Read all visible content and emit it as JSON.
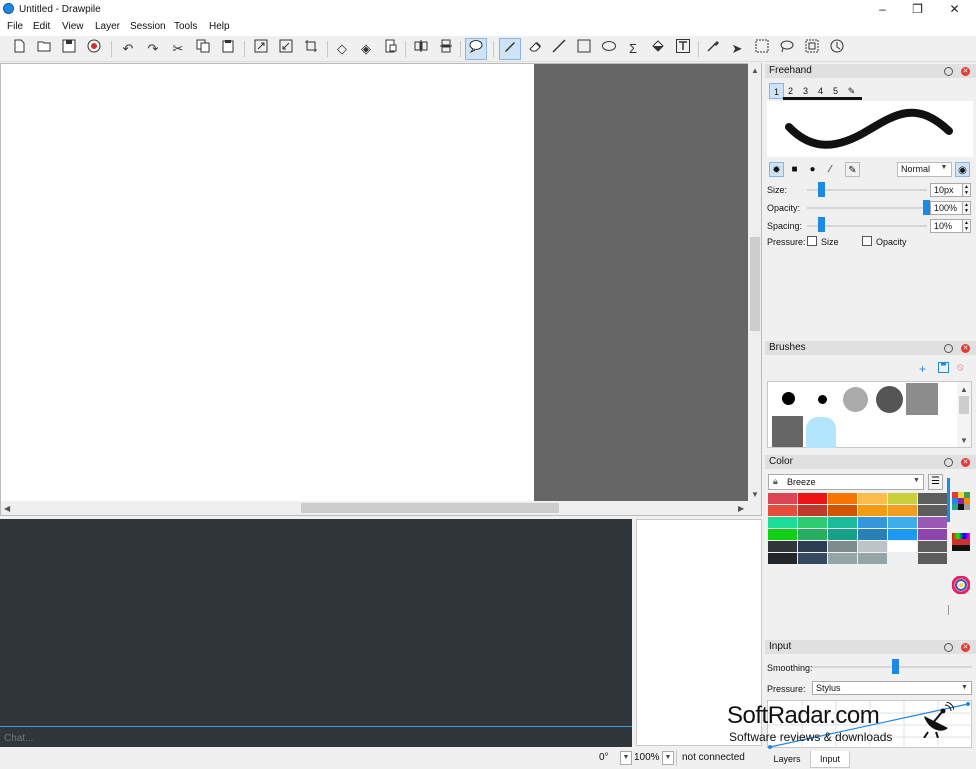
{
  "window": {
    "title": "Untitled - Drawpile",
    "minimize_glyph": "–",
    "maximize_glyph": "❐",
    "close_glyph": "✕"
  },
  "menu": [
    "File",
    "Edit",
    "View",
    "Layer",
    "Session",
    "Tools",
    "Help"
  ],
  "toolbar": {
    "icons": [
      "new-icon",
      "open-icon",
      "save-icon",
      "record-icon",
      "undo-icon",
      "redo-icon",
      "cut-icon",
      "copy-icon",
      "paste-icon",
      "expand-icon",
      "shrink-icon",
      "crop-icon",
      "flip-icon",
      "mirror-icon",
      "rotate-icon",
      "layout-icon",
      "layout-vertical-icon",
      "chat-icon",
      "freehand-icon",
      "eraser-icon",
      "line-icon",
      "rectangle-icon",
      "ellipse-icon",
      "bezier-icon",
      "fill-icon",
      "text-icon",
      "colorpicker-icon",
      "laser-icon",
      "select-rect-icon",
      "select-lasso-icon",
      "zoom-icon",
      "inspector-icon"
    ],
    "active": [
      "chat-icon",
      "freehand-icon"
    ]
  },
  "freehand": {
    "title": "Freehand",
    "tabs": [
      "1",
      "2",
      "3",
      "4",
      "5",
      "✎"
    ],
    "active_tab": "1",
    "blend_mode": "Normal",
    "size_label": "Size:",
    "size_value": "10px",
    "size_level": 0.1,
    "opacity_label": "Opacity:",
    "opacity_value": "100%",
    "opacity_level": 1.0,
    "spacing_label": "Spacing:",
    "spacing_value": "10%",
    "spacing_level": 0.1,
    "pressure_label": "Pressure:",
    "pressure_size": "Size",
    "pressure_opacity": "Opacity"
  },
  "brushes": {
    "title": "Brushes"
  },
  "color": {
    "title": "Color",
    "palette_name": "Breeze",
    "swatches": [
      "#da4453",
      "#ed1515",
      "#f67400",
      "#fdbc4b",
      "#c9ce3b",
      "#5d5d5d",
      "#e74c3c",
      "#c0392b",
      "#d35400",
      "#f39c12",
      "#f39c1f",
      "#5d5d5d",
      "#1cdc9a",
      "#2ecc71",
      "#1abc9c",
      "#3498db",
      "#3daee9",
      "#9b59b6",
      "#11d116",
      "#27ae60",
      "#16a085",
      "#2980b9",
      "#1d99f3",
      "#8e44ad",
      "#31363b",
      "#2c3e50",
      "#7f8c8d",
      "#bdc3c7",
      "#ffffff",
      "#5d5d5d",
      "#232629",
      "#34495e",
      "#95a5a6",
      "#95a5a6",
      "#eff0f1",
      "#5d5d5d"
    ]
  },
  "input": {
    "title": "Input",
    "smoothing_label": "Smoothing:",
    "smoothing_level": 0.6,
    "pressure_label": "Pressure:",
    "pressure_mode": "Stylus"
  },
  "bottom_tabs": [
    "Layers",
    "Input"
  ],
  "active_bottom_tab": "Input",
  "chat": {
    "placeholder": "Chat..."
  },
  "status": {
    "rotation": "0°",
    "zoom": "100%",
    "connection": "not connected"
  },
  "watermark": {
    "name": "SoftRadar.com",
    "tagline": "Software reviews & downloads"
  }
}
